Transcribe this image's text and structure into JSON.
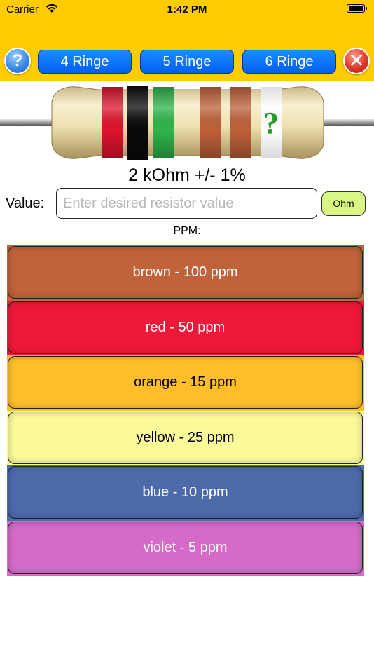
{
  "status_bar": {
    "carrier": "Carrier",
    "time": "1:42 PM"
  },
  "toolbar": {
    "help_label": "?",
    "close_label": "✕",
    "ring_buttons": [
      "4 Ringe",
      "5 Ringe",
      "6 Ringe"
    ]
  },
  "resistor": {
    "bands": [
      "#e0142e",
      "#0a0a0a",
      "#2fb54a",
      "#c0623a",
      "#c0623a",
      "#ffffff"
    ],
    "unknown_band_label": "?"
  },
  "result": {
    "value_text": "2 kOhm +/- 1%"
  },
  "value_input": {
    "label": "Value:",
    "placeholder": "Enter desired resistor value",
    "value": "",
    "unit_button": "Ohm"
  },
  "ppm": {
    "heading": "PPM:",
    "options": [
      {
        "label": "brown - 100 ppm",
        "color": "#c0623a",
        "text_color": "#ffffff"
      },
      {
        "label": "red - 50 ppm",
        "color": "#ee1838",
        "text_color": "#ffffff"
      },
      {
        "label": "orange - 15 ppm",
        "color": "#ffbe2a",
        "text_color": "#000000"
      },
      {
        "label": "yellow - 25 ppm",
        "color": "#fafa98",
        "text_color": "#000000"
      },
      {
        "label": "blue - 10 ppm",
        "color": "#4d6aab",
        "text_color": "#ffffff"
      },
      {
        "label": "violet - 5 ppm",
        "color": "#d66ac9",
        "text_color": "#ffffff"
      }
    ]
  }
}
